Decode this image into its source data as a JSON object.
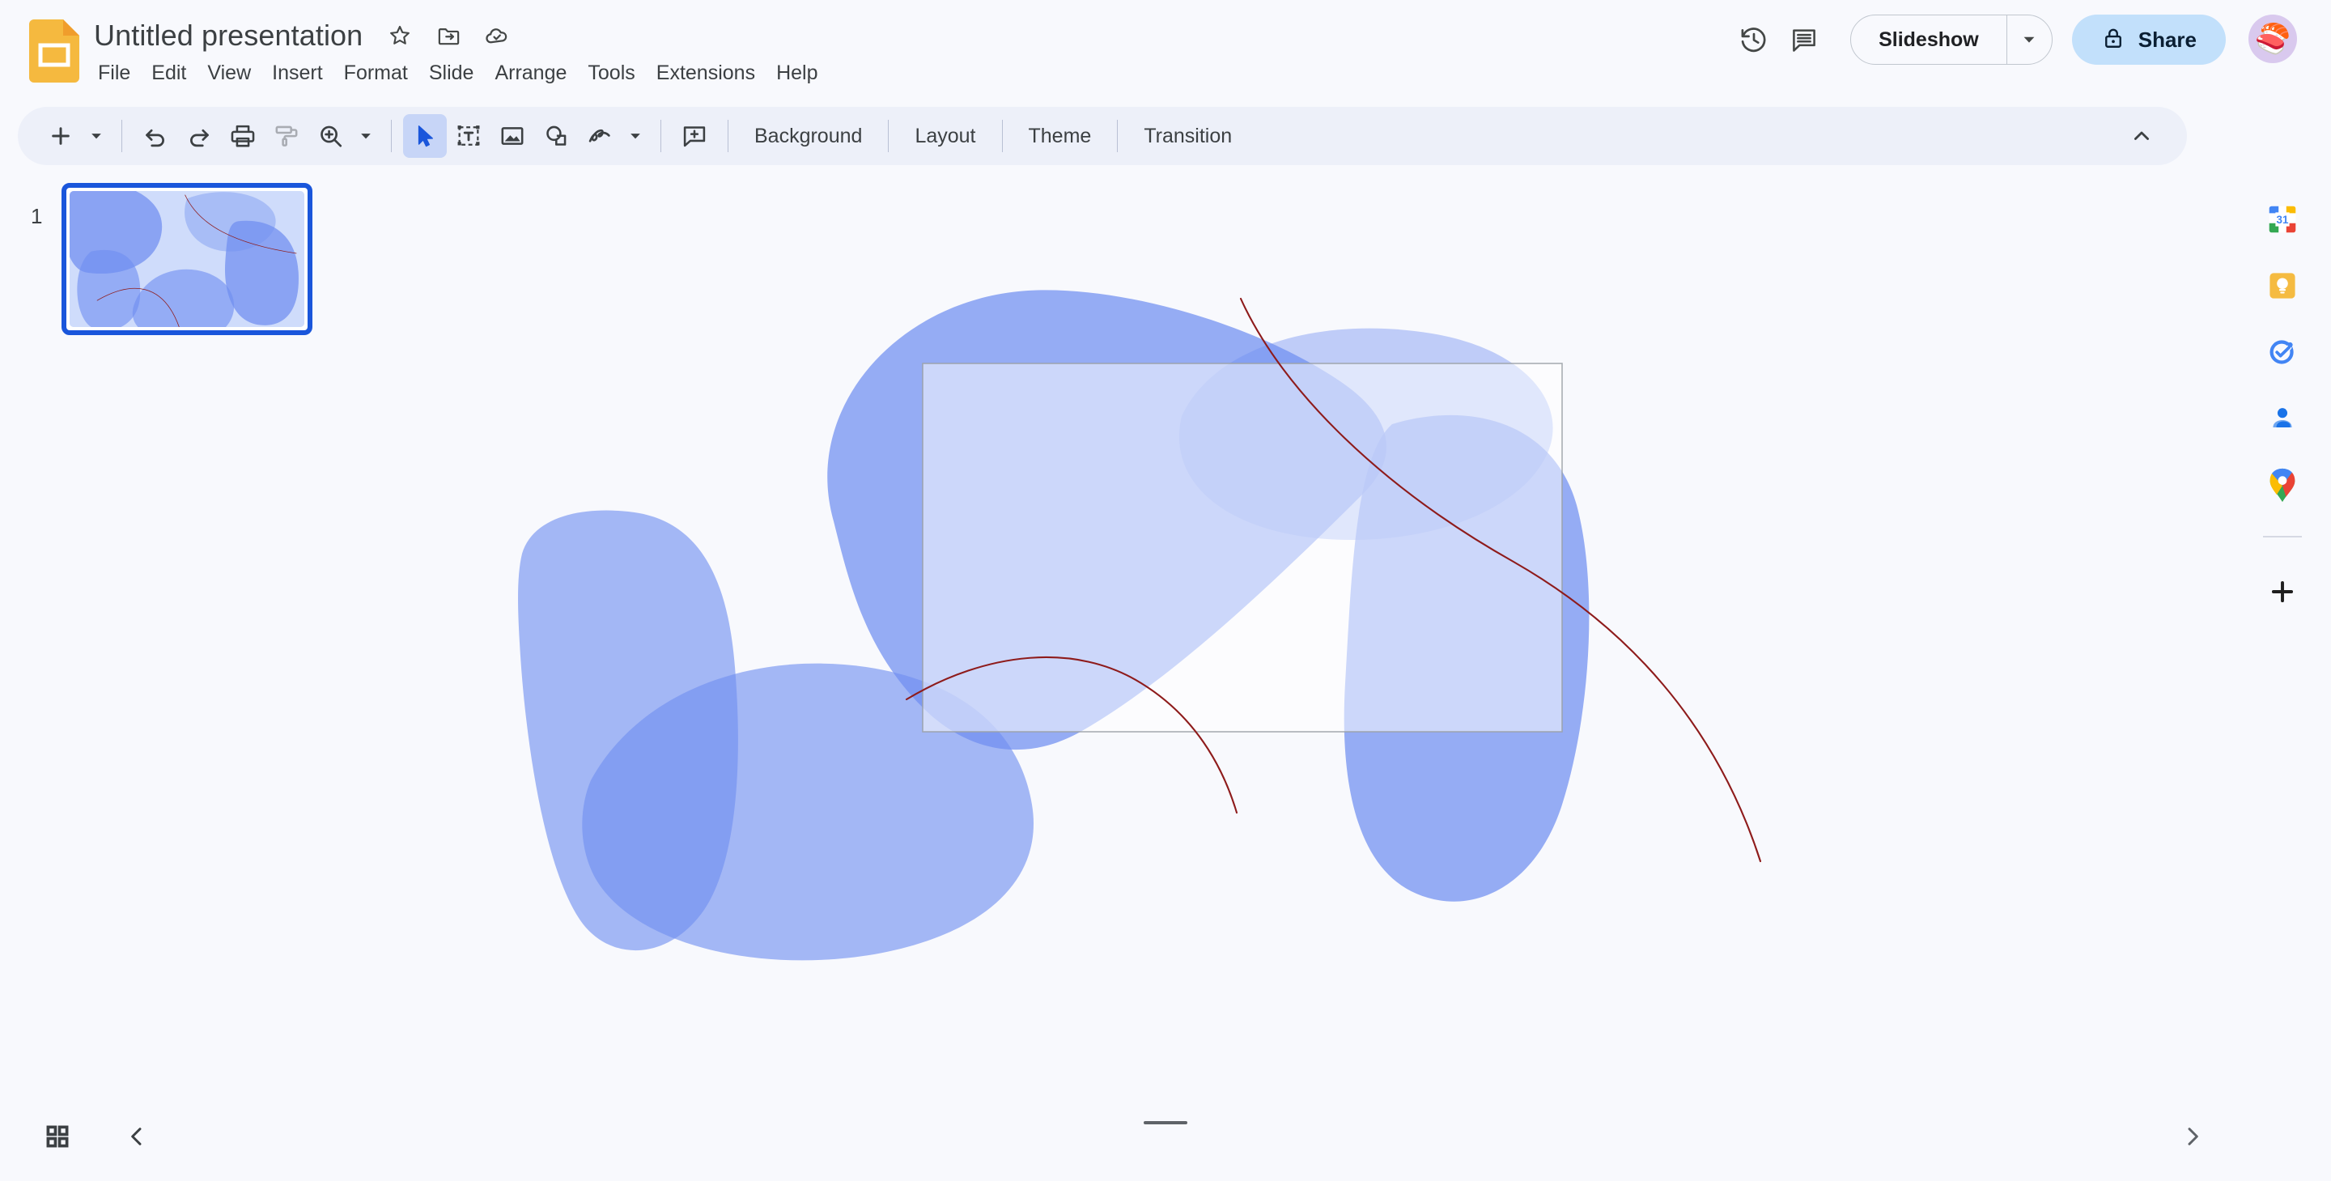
{
  "app": {
    "name": "Google Slides",
    "logo_icon": "slides-logo-icon",
    "bg_color": "#f8f9fd",
    "accent_color": "#1a56db"
  },
  "titlebar": {
    "doc_title": "Untitled presentation",
    "icons": [
      {
        "name": "star-icon",
        "label": "Star"
      },
      {
        "name": "move-to-folder-icon",
        "label": "Move"
      },
      {
        "name": "cloud-saved-icon",
        "label": "Saved to Drive"
      }
    ]
  },
  "menubar": {
    "items": [
      {
        "label": "File"
      },
      {
        "label": "Edit"
      },
      {
        "label": "View"
      },
      {
        "label": "Insert"
      },
      {
        "label": "Format"
      },
      {
        "label": "Slide"
      },
      {
        "label": "Arrange"
      },
      {
        "label": "Tools"
      },
      {
        "label": "Extensions"
      },
      {
        "label": "Help"
      }
    ]
  },
  "header_actions": {
    "history_icon": "version-history-icon",
    "comment_icon": "open-comment-history-icon",
    "slideshow_label": "Slideshow",
    "slideshow_caret_icon": "chevron-down-icon",
    "share_label": "Share",
    "share_lock_icon": "lock-icon",
    "share_bg": "#c2e0fb",
    "avatar_emoji": "🍣",
    "avatar_bg": "#d9c9ee"
  },
  "toolbar": {
    "bg": "#edf0f9",
    "new_slide_icon": "plus-icon",
    "new_slide_caret_icon": "chevron-down-icon",
    "undo_icon": "undo-icon",
    "redo_icon": "redo-icon",
    "print_icon": "print-icon",
    "paint_format_icon": "paint-format-icon",
    "zoom_icon": "zoom-icon",
    "zoom_caret_icon": "chevron-down-icon",
    "select_icon": "select-cursor-icon",
    "textbox_icon": "text-box-icon",
    "image_icon": "insert-image-icon",
    "shape_icon": "insert-shape-icon",
    "line_icon": "insert-line-icon",
    "line_caret_icon": "chevron-down-icon",
    "comment_icon": "add-comment-icon",
    "background_label": "Background",
    "layout_label": "Layout",
    "theme_label": "Theme",
    "transition_label": "Transition",
    "collapse_icon": "chevron-up-icon"
  },
  "filmstrip": {
    "slides": [
      {
        "number": "1",
        "selected": true
      }
    ]
  },
  "slide": {
    "background": "#ffffff",
    "shapes": [
      {
        "name": "blob-top-left",
        "fill": "#6f8ef0",
        "opacity": 0.72
      },
      {
        "name": "blob-left-lower",
        "fill": "#6f8ef0",
        "opacity": 0.62
      },
      {
        "name": "blob-center-bottom",
        "fill": "#6f8ef0",
        "opacity": 0.62
      },
      {
        "name": "blob-top-right",
        "fill": "#6f8ef0",
        "opacity": 0.42
      },
      {
        "name": "blob-right",
        "fill": "#6f8ef0",
        "opacity": 0.72
      },
      {
        "name": "overlay-rectangle",
        "fill": "#ffffff",
        "opacity": 0.55,
        "stroke": "#9aa0a6"
      },
      {
        "name": "red-curve-left",
        "stroke": "#8e1b1b",
        "width": 2
      },
      {
        "name": "red-curve-right",
        "stroke": "#8e1b1b",
        "width": 2
      }
    ]
  },
  "rightbar": {
    "items": [
      {
        "name": "google-calendar-icon",
        "label": "Calendar",
        "badge": "31"
      },
      {
        "name": "google-keep-icon",
        "label": "Keep"
      },
      {
        "name": "google-tasks-icon",
        "label": "Tasks"
      },
      {
        "name": "google-contacts-icon",
        "label": "Contacts"
      },
      {
        "name": "google-maps-icon",
        "label": "Maps"
      }
    ],
    "add_ons_icon": "plus-icon",
    "add_ons_label": "Get add-ons"
  },
  "bottombar": {
    "grid_view_icon": "grid-view-icon",
    "collapse_filmstrip_icon": "chevron-left-icon",
    "expand_notes_icon": "chevron-right-icon",
    "notes_handle": "speaker-notes-resize-handle"
  }
}
